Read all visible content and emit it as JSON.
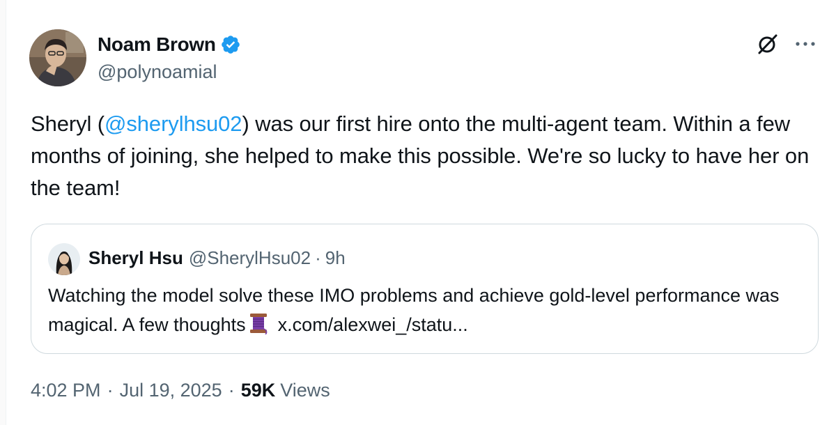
{
  "author": {
    "name": "Noam Brown",
    "handle": "@polynoamial",
    "verified": true,
    "avatar_icon": "person-photo-icon"
  },
  "post": {
    "text_before": "Sheryl (",
    "mention": "@sherylhsu02",
    "text_after": ") was our first hire onto the multi-agent team. Within a few months of joining, she helped to make this possible. We're so lucky to have her on the team!"
  },
  "quote": {
    "name": "Sheryl Hsu",
    "handle": "@SherylHsu02",
    "separator": "·",
    "time": "9h",
    "text": "Watching the model solve these IMO problems and achieve gold-level performance was magical. A few thoughts",
    "emoji_icon": "thread-spool-icon",
    "link": "x.com/alexwei_/statu..."
  },
  "meta": {
    "time": "4:02 PM",
    "separator": "·",
    "date": "Jul 19, 2025",
    "views_count": "59K",
    "views_label": "Views"
  },
  "colors": {
    "accent": "#1d9bf0",
    "text": "#0f1419",
    "muted": "#536471",
    "border": "#cfd9de"
  }
}
